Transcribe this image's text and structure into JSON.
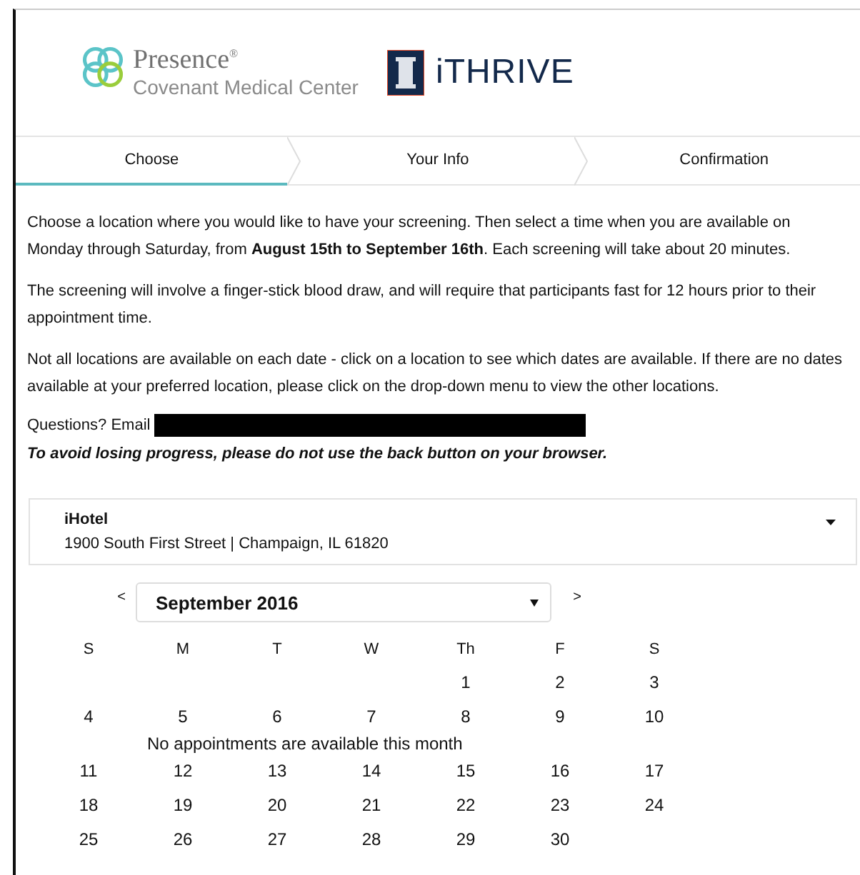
{
  "header": {
    "presence": {
      "name": "Presence$^{®}$",
      "subtitle": "Covenant Medical Center"
    },
    "ithrive": {
      "name": "iTHRIVE"
    }
  },
  "steps": [
    {
      "label": "Choose",
      "selected": true
    },
    {
      "label": "Your Info",
      "selected": false
    },
    {
      "label": "Confirmation",
      "selected": false
    }
  ],
  "intro": [
    "Choose a location where you would like to have your screening. Then select a time when you are available on Monday through Saturday, from **August 15th to September 16th**. Each screening will take about 20 minutes.",
    "The screening will involve a finger-stick blood draw, and will require that participants fast for 12 hours prior to their appointment time.",
    "Not all locations are available on each date - click on a location to see which dates are available. If there are no dates available at your preferred location, please click on the drop-down menu to view the other locations."
  ],
  "questions": {
    "label": "Questions? Email"
  },
  "warning": "To avoid losing progress, please do not use the back button on your browser.",
  "location": {
    "name": "iHotel",
    "address": "1900 South First Street | Champaign, IL 61820"
  },
  "calendar": {
    "prev": "<",
    "next": ">",
    "month": "September 2016",
    "notice": "No appointments are available this month",
    "weekdays": [
      "S",
      "M",
      "T",
      "W",
      "Th",
      "F",
      "S"
    ],
    "weeks": [
      {
        "kind": "trailing",
        "days": [
          "1",
          "2",
          "3"
        ]
      },
      {
        "kind": "leading",
        "days": [
          "4",
          "5",
          "6",
          "7",
          "8",
          "9",
          "10"
        ]
      },
      {
        "kind": "leading",
        "days": [
          "11",
          "12",
          "13",
          "14",
          "15",
          "16",
          "17"
        ]
      },
      {
        "kind": "leading",
        "days": [
          "18",
          "19",
          "20",
          "21",
          "22",
          "23",
          "24"
        ]
      },
      {
        "kind": "leading",
        "days": [
          "25",
          "26",
          "27",
          "28",
          "29",
          "30"
        ]
      }
    ]
  }
}
